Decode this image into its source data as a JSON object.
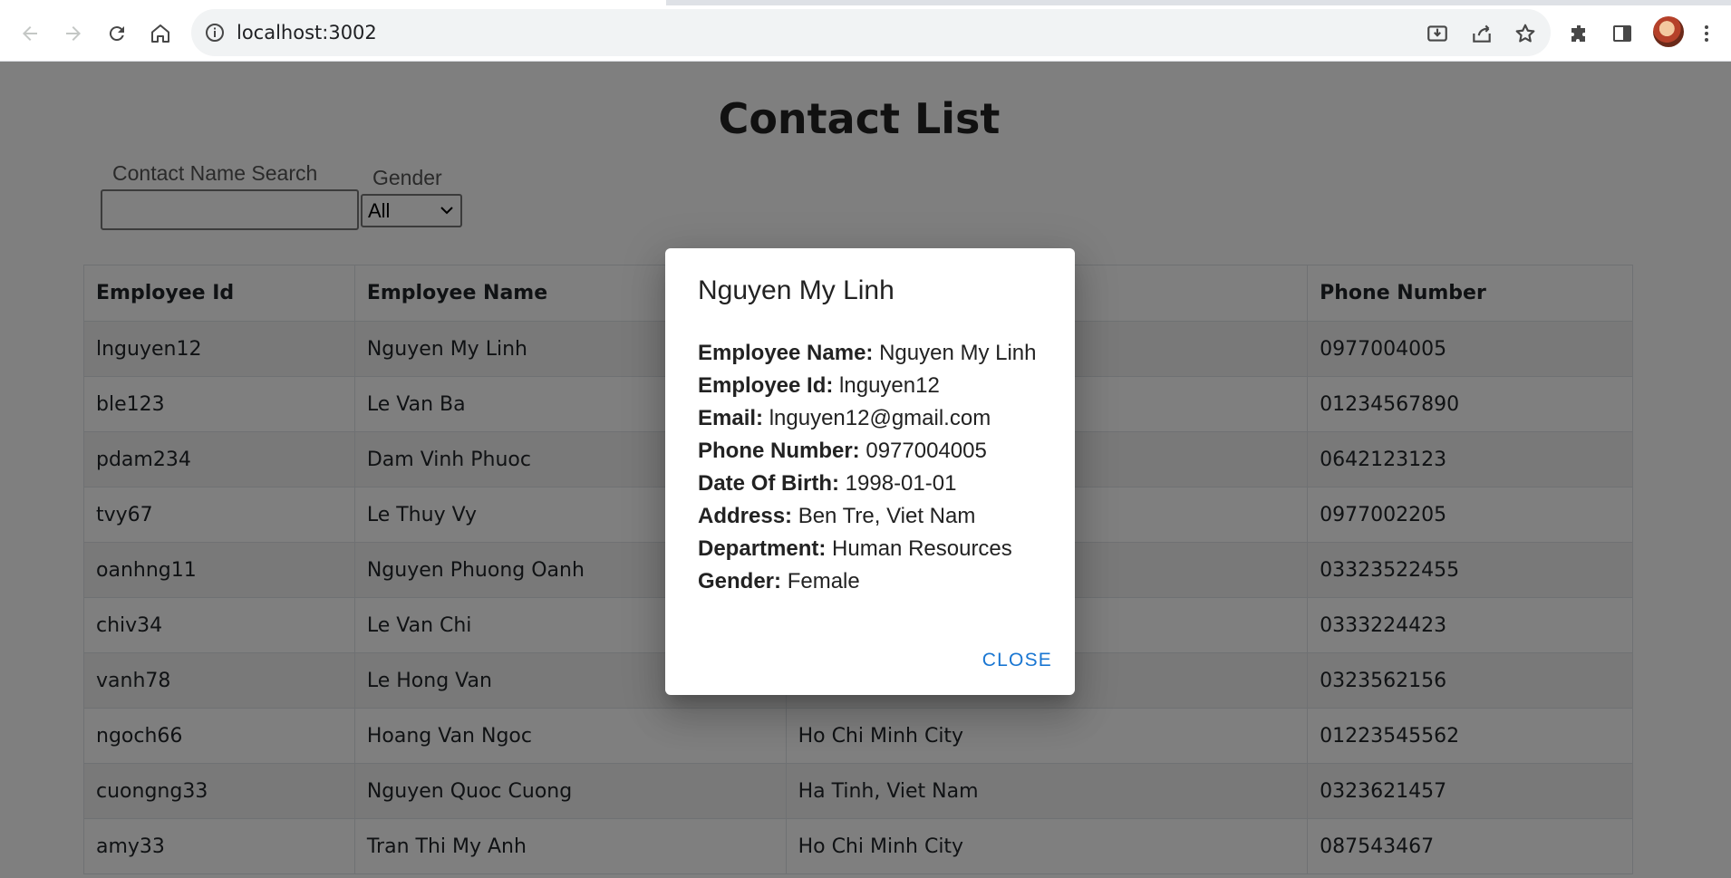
{
  "browser": {
    "url": "localhost:3002"
  },
  "page": {
    "title": "Contact List",
    "filters": {
      "search_label": "Contact Name Search",
      "search_value": "",
      "gender_label": "Gender",
      "gender_selected": "All"
    },
    "table": {
      "headers": [
        "Employee Id",
        "Employee Name",
        "",
        "Phone Number"
      ],
      "rows": [
        [
          "lnguyen12",
          "Nguyen My Linh",
          "",
          "0977004005"
        ],
        [
          "ble123",
          "Le Van Ba",
          "",
          "01234567890"
        ],
        [
          "pdam234",
          "Dam Vinh Phuoc",
          "",
          "0642123123"
        ],
        [
          "tvy67",
          "Le Thuy Vy",
          "",
          "0977002205"
        ],
        [
          "oanhng11",
          "Nguyen Phuong Oanh",
          "",
          "03323522455"
        ],
        [
          "chiv34",
          "Le Van Chi",
          "",
          "0333224423"
        ],
        [
          "vanh78",
          "Le Hong Van",
          "",
          "0323562156"
        ],
        [
          "ngoch66",
          "Hoang Van Ngoc",
          "Ho Chi Minh City",
          "01223545562"
        ],
        [
          "cuongng33",
          "Nguyen Quoc Cuong",
          "Ha Tinh, Viet Nam",
          "0323621457"
        ],
        [
          "amy33",
          "Tran Thi My Anh",
          "Ho Chi Minh City",
          "087543467"
        ]
      ]
    }
  },
  "modal": {
    "title": "Nguyen My Linh",
    "fields": [
      {
        "label": "Employee Name:",
        "value": "Nguyen My Linh"
      },
      {
        "label": "Employee Id:",
        "value": "lnguyen12"
      },
      {
        "label": "Email:",
        "value": "lnguyen12@gmail.com"
      },
      {
        "label": "Phone Number:",
        "value": "0977004005"
      },
      {
        "label": "Date Of Birth:",
        "value": "1998-01-01"
      },
      {
        "label": "Address:",
        "value": "Ben Tre, Viet Nam"
      },
      {
        "label": "Department:",
        "value": "Human Resources"
      },
      {
        "label": "Gender:",
        "value": "Female"
      }
    ],
    "close_label": "CLOSE"
  },
  "icons": {
    "back": "back-arrow-icon",
    "forward": "forward-arrow-icon",
    "reload": "reload-icon",
    "home": "home-icon",
    "site_info": "info-icon",
    "install": "install-app-icon",
    "share": "share-icon",
    "bookmark": "star-icon",
    "extensions": "puzzle-icon",
    "side_panel": "side-panel-icon",
    "menu": "kebab-menu-icon"
  },
  "colors": {
    "link_blue": "#1976d2",
    "overlay": "rgba(0,0,0,0.5)"
  }
}
